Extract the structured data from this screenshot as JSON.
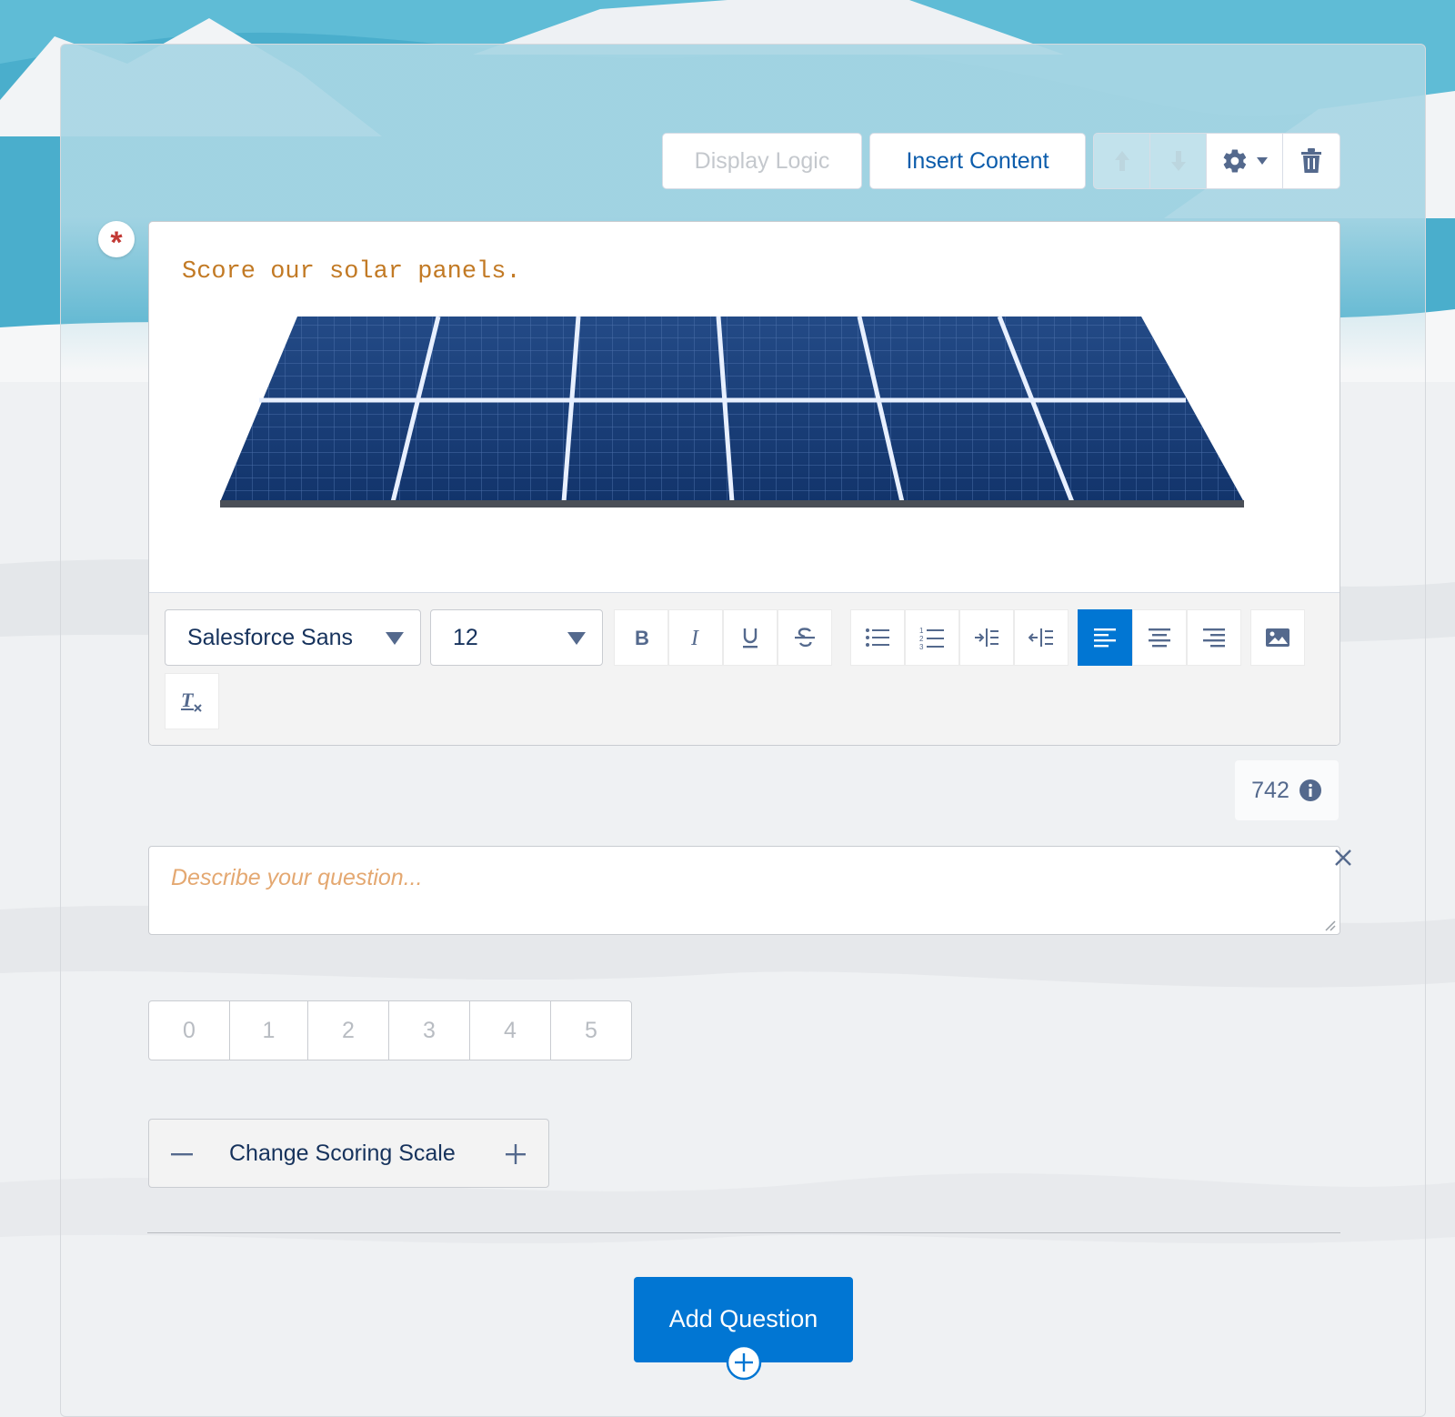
{
  "header": {
    "display_logic_label": "Display Logic",
    "insert_content_label": "Insert Content"
  },
  "question": {
    "required_marker": "*",
    "text": "Score our solar panels.",
    "character_count": "742"
  },
  "toolbar": {
    "font_family_value": "Salesforce Sans",
    "font_size_value": "12"
  },
  "description": {
    "placeholder": "Describe your question..."
  },
  "scale": {
    "options": [
      "0",
      "1",
      "2",
      "3",
      "4",
      "5"
    ]
  },
  "scale_changer": {
    "label": "Change Scoring Scale"
  },
  "footer": {
    "add_question_label": "Add Question"
  },
  "colors": {
    "brand_blue": "#0176d3",
    "required_red": "#c23934",
    "question_text": "#c27a25",
    "placeholder_text": "#e4a871"
  }
}
